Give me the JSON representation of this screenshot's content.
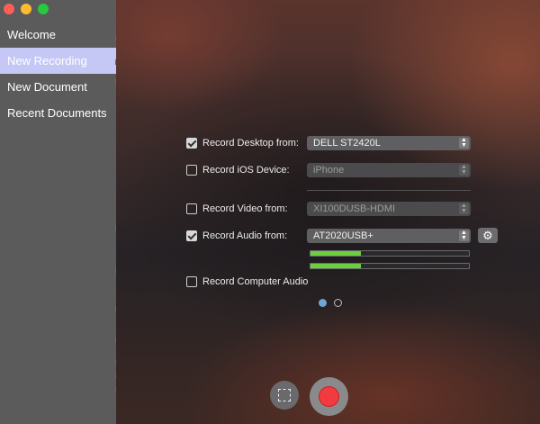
{
  "sidebar": {
    "items": [
      {
        "label": "Welcome",
        "active": false
      },
      {
        "label": "New Recording",
        "active": true
      },
      {
        "label": "New Document",
        "active": false
      },
      {
        "label": "Recent Documents",
        "active": false
      }
    ]
  },
  "options": {
    "record_desktop": {
      "label": "Record Desktop from:",
      "checked": true,
      "value": "DELL ST2420L",
      "enabled": true
    },
    "record_ios": {
      "label": "Record iOS Device:",
      "checked": false,
      "value": "iPhone",
      "enabled": false
    },
    "record_video": {
      "label": "Record Video from:",
      "checked": false,
      "value": "XI100DUSB-HDMI",
      "enabled": false
    },
    "record_audio": {
      "label": "Record Audio from:",
      "checked": true,
      "value": "AT2020USB+",
      "enabled": true
    },
    "record_computer_audio": {
      "label": "Record Computer Audio",
      "checked": false
    }
  },
  "audio_levels": [
    0.32,
    0.32
  ],
  "pager": {
    "count": 2,
    "active_index": 0
  },
  "colors": {
    "accent_selection": "#c5c8f5",
    "record_red": "#f23b3f",
    "meter_green": "#6bd03e",
    "page_dot_active": "#6ea7d6"
  },
  "icons": {
    "gear": "gear-icon",
    "region": "selection-region-icon",
    "record": "record-icon"
  }
}
